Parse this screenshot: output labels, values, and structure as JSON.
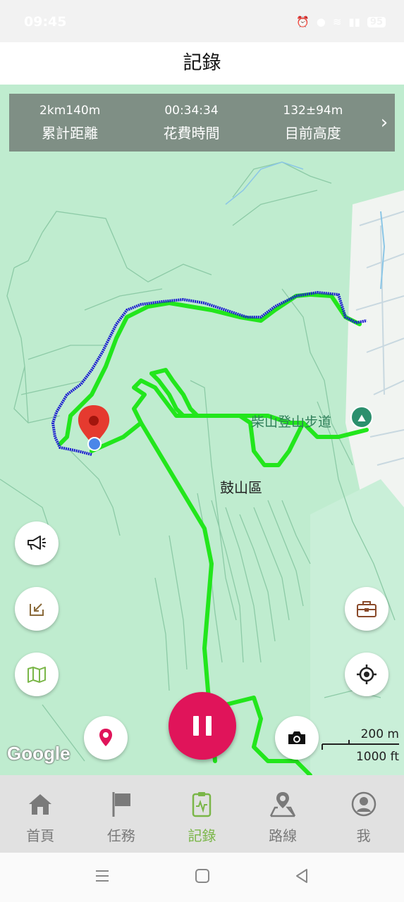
{
  "status_bar": {
    "time": "09:45",
    "battery": "95"
  },
  "header": {
    "title": "記錄"
  },
  "stats": [
    {
      "value": "2km140m",
      "label": "累計距離"
    },
    {
      "value": "00:34:34",
      "label": "花費時間"
    },
    {
      "value": "132±94m",
      "label": "目前高度"
    }
  ],
  "map": {
    "area_label": "鼓山區",
    "trail_label": "柴山登山步道",
    "attribution": "Google",
    "scale_metric": "200 m",
    "scale_imperial": "1000 ft"
  },
  "tabs": [
    {
      "label": "首頁",
      "icon": "home-icon",
      "active": false
    },
    {
      "label": "任務",
      "icon": "flag-icon",
      "active": false
    },
    {
      "label": "記錄",
      "icon": "record-clipboard-icon",
      "active": true
    },
    {
      "label": "路線",
      "icon": "route-map-icon",
      "active": false
    },
    {
      "label": "我",
      "icon": "profile-icon",
      "active": false
    }
  ],
  "colors": {
    "accent": "#7ab648",
    "pause": "#e0145a",
    "track_recorded": "#22e61c",
    "track_live": "#1a1ad0",
    "stats_bg": "#7f8f85"
  }
}
